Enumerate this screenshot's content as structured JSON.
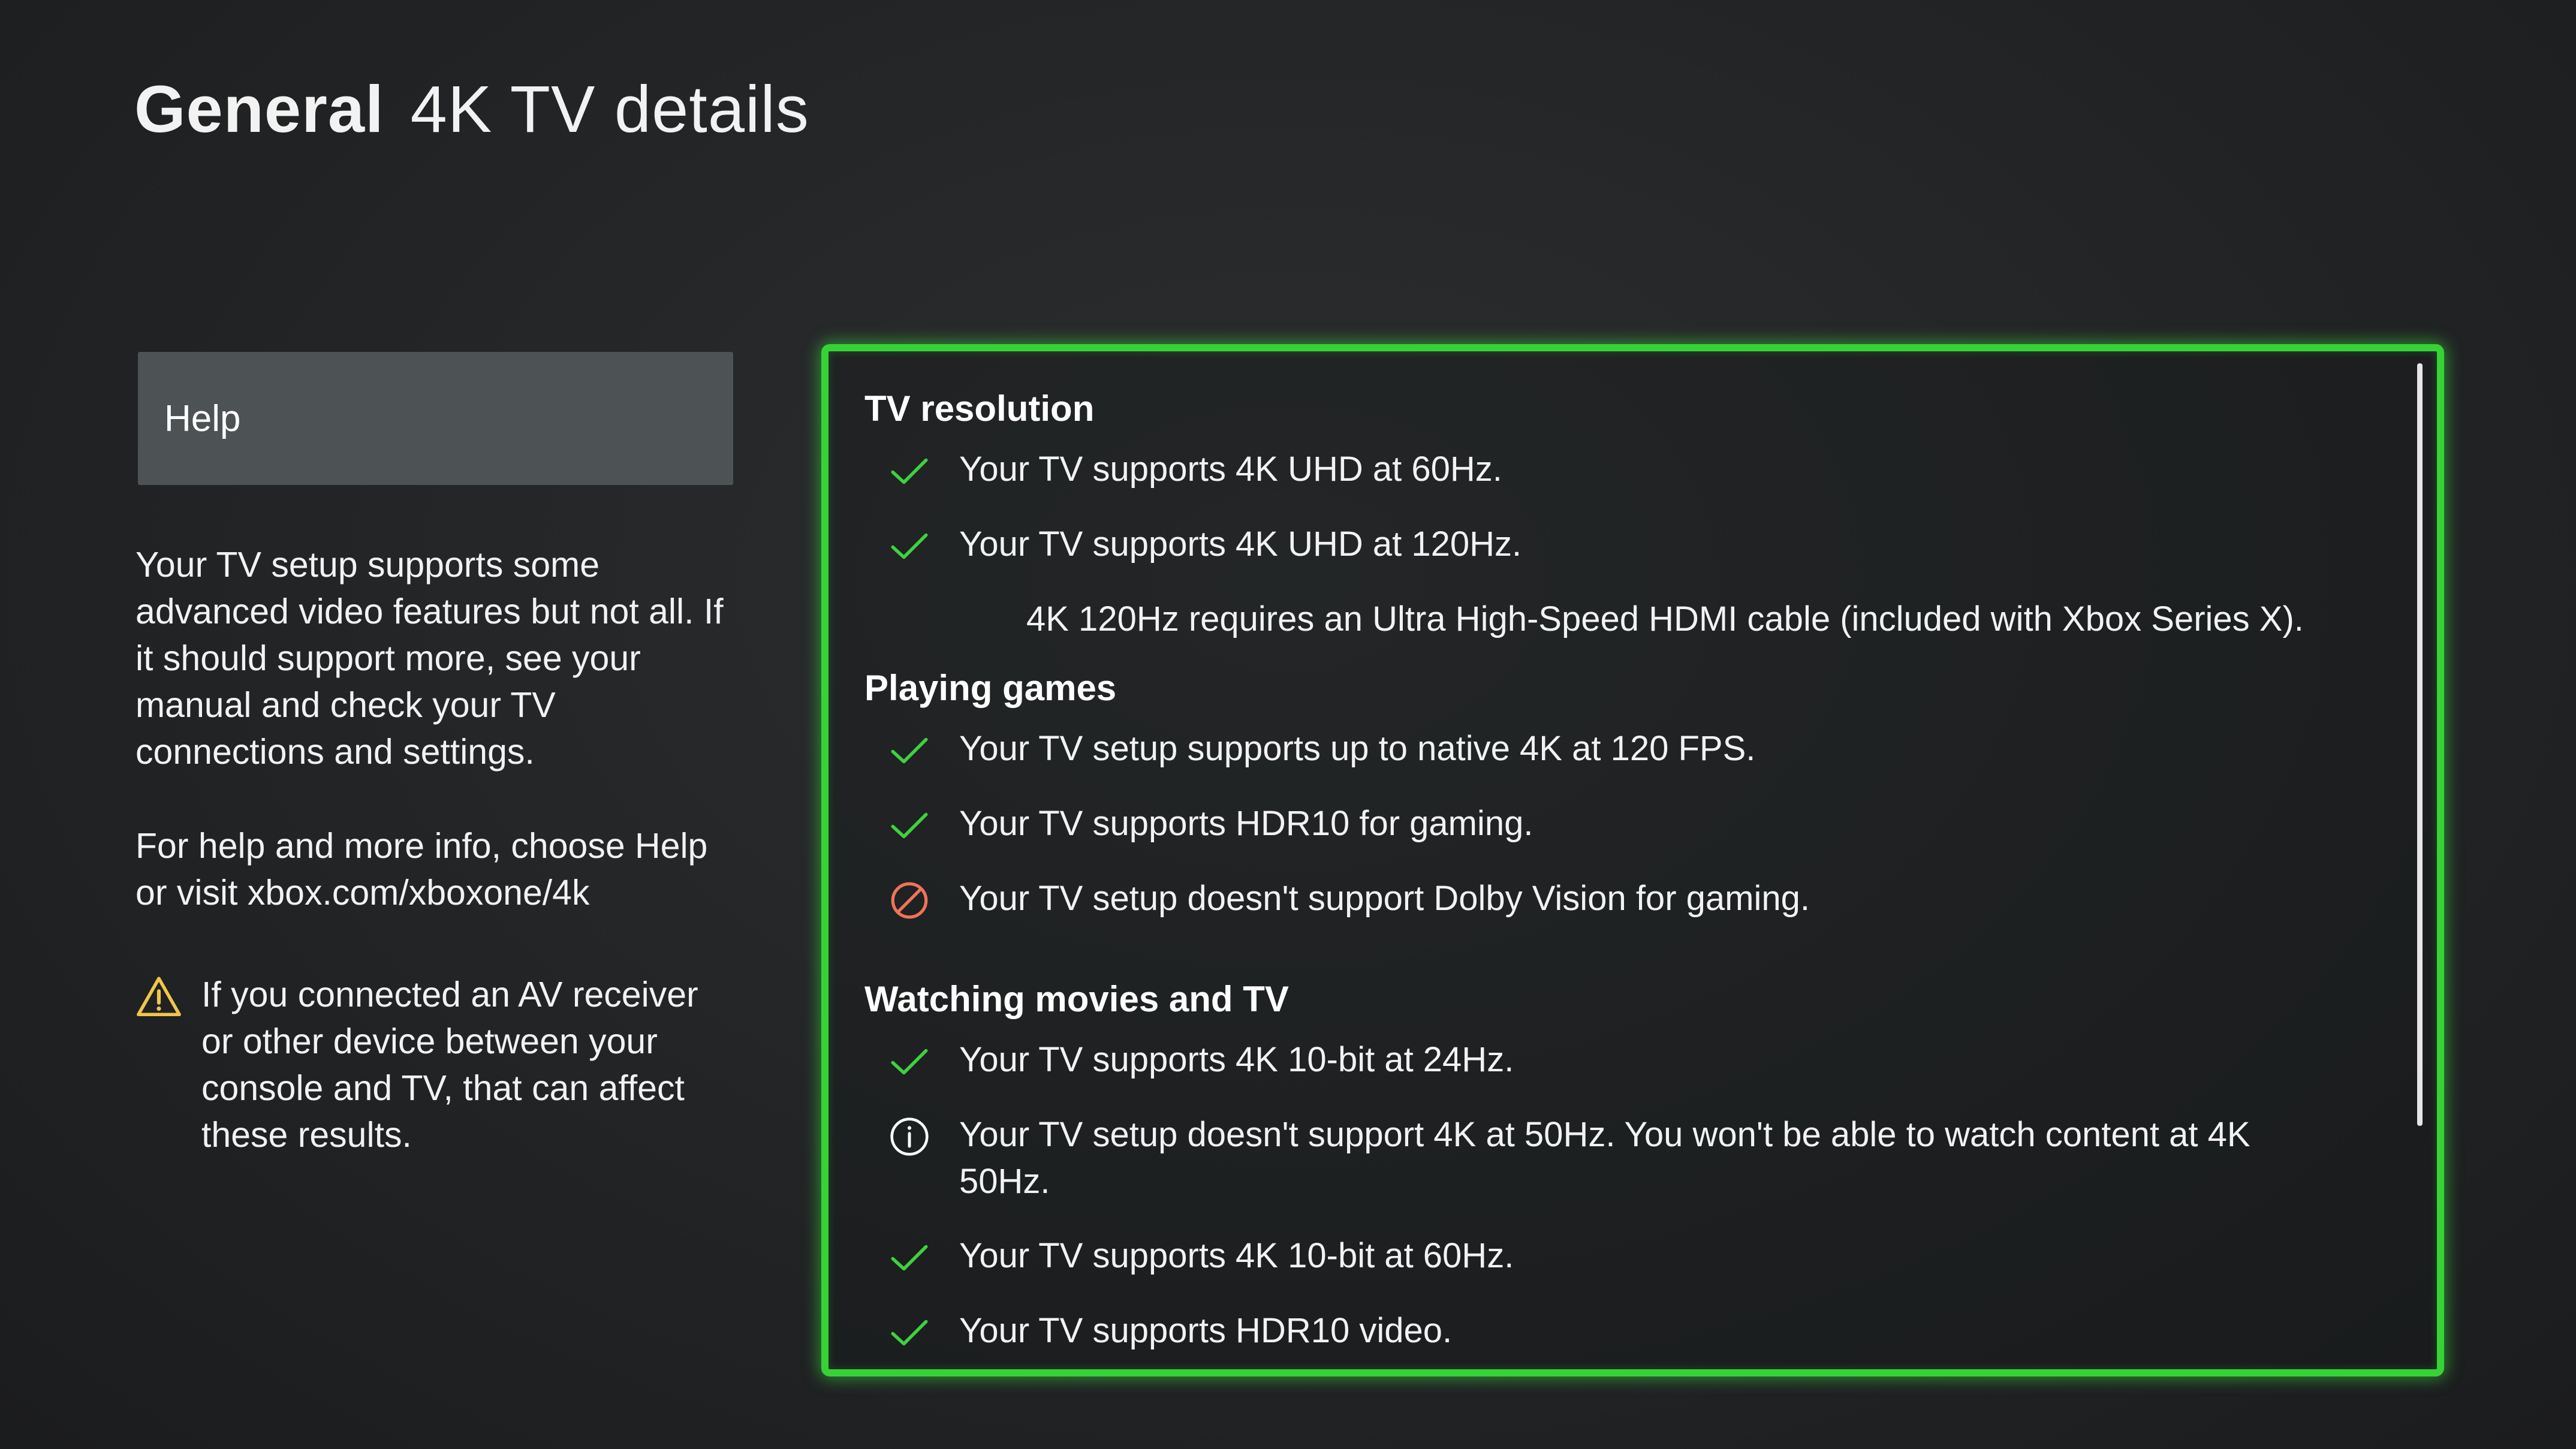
{
  "header": {
    "section": "General",
    "title": "4K TV details"
  },
  "sidebar": {
    "help_button_label": "Help",
    "paragraph1": "Your TV setup supports some advanced video features but not all. If it should support more, see your manual and check your TV connections and settings.",
    "paragraph2": "For help and more info, choose Help or visit xbox.com/xboxone/4k",
    "warning_text": "If you connected an AV receiver or other device between your console and TV, that can affect these results.",
    "warning_icon": "warning-triangle-icon"
  },
  "details": {
    "tv_resolution": {
      "heading": "TV resolution",
      "items": [
        {
          "status": "supported",
          "icon": "check-icon",
          "text": "Your TV supports 4K UHD at 60Hz."
        },
        {
          "status": "supported",
          "icon": "check-icon",
          "text": "Your TV supports 4K UHD at 120Hz."
        }
      ],
      "note": "4K 120Hz requires an Ultra High-Speed HDMI cable (included with Xbox Series X)."
    },
    "playing_games": {
      "heading": "Playing games",
      "items": [
        {
          "status": "supported",
          "icon": "check-icon",
          "text": "Your TV setup supports up to native 4K at 120 FPS."
        },
        {
          "status": "supported",
          "icon": "check-icon",
          "text": "Your TV supports HDR10 for gaming."
        },
        {
          "status": "unsupported",
          "icon": "prohibited-icon",
          "text": "Your TV setup doesn't support Dolby Vision for gaming."
        }
      ]
    },
    "watching": {
      "heading": "Watching movies and TV",
      "items": [
        {
          "status": "supported",
          "icon": "check-icon",
          "text": "Your TV supports 4K 10-bit at 24Hz."
        },
        {
          "status": "info",
          "icon": "info-icon",
          "text": "Your TV setup doesn't support 4K at 50Hz. You won't be able to watch content at 4K 50Hz."
        },
        {
          "status": "supported",
          "icon": "check-icon",
          "text": "Your TV supports 4K 10-bit at 60Hz."
        },
        {
          "status": "supported",
          "icon": "check-icon",
          "text": "Your TV supports HDR10 video."
        }
      ]
    }
  },
  "colors": {
    "focus_border": "#36d336",
    "check": "#3fd13f",
    "prohibited": "#f0735a",
    "warning": "#f0c64a",
    "info": "#ffffff",
    "help_button_bg": "#4d5254"
  }
}
